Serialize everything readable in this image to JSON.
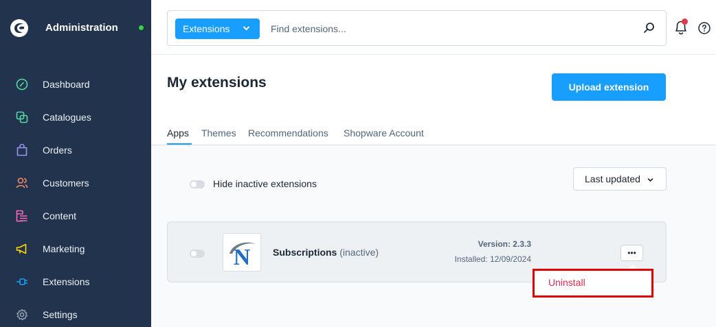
{
  "colors": {
    "sidebar_bg": "#21334d",
    "accent": "#189eff",
    "status_online": "#37d046",
    "danger": "#de294c",
    "highlight_border": "#e00000"
  },
  "brand": {
    "title": "Administration",
    "logo_icon": "shopware-logo-icon"
  },
  "nav": {
    "items": [
      {
        "label": "Dashboard",
        "icon": "dashboard-gauge-icon",
        "color": "#57d9a3"
      },
      {
        "label": "Catalogues",
        "icon": "catalogue-products-icon",
        "color": "#57d9a3"
      },
      {
        "label": "Orders",
        "icon": "shopping-bag-icon",
        "color": "#a092f0"
      },
      {
        "label": "Customers",
        "icon": "customers-users-icon",
        "color": "#f88962"
      },
      {
        "label": "Content",
        "icon": "content-layout-icon",
        "color": "#ff68b4"
      },
      {
        "label": "Marketing",
        "icon": "megaphone-icon",
        "color": "#ffd700"
      },
      {
        "label": "Extensions",
        "icon": "plug-icon",
        "color": "#189eff"
      },
      {
        "label": "Settings",
        "icon": "gear-icon",
        "color": "#9aa8b5"
      }
    ]
  },
  "search": {
    "type_label": "Extensions",
    "placeholder": "Find extensions..."
  },
  "header": {
    "title": "My extensions",
    "upload_label": "Upload extension"
  },
  "tabs": [
    {
      "label": "Apps",
      "active": true
    },
    {
      "label": "Themes",
      "active": false
    },
    {
      "label": "Recommendations",
      "active": false
    },
    {
      "label": "Shopware Account",
      "active": false
    }
  ],
  "filters": {
    "hide_inactive_label": "Hide inactive extensions",
    "sort_label": "Last updated"
  },
  "extension": {
    "name": "Subscriptions",
    "status": "(inactive)",
    "version": "Version: 2.3.3",
    "installed": "Installed: 12/09/2024",
    "logo_letter": "N",
    "more_label": "•••"
  },
  "context_menu": {
    "items": [
      {
        "label": "Uninstall"
      }
    ]
  }
}
